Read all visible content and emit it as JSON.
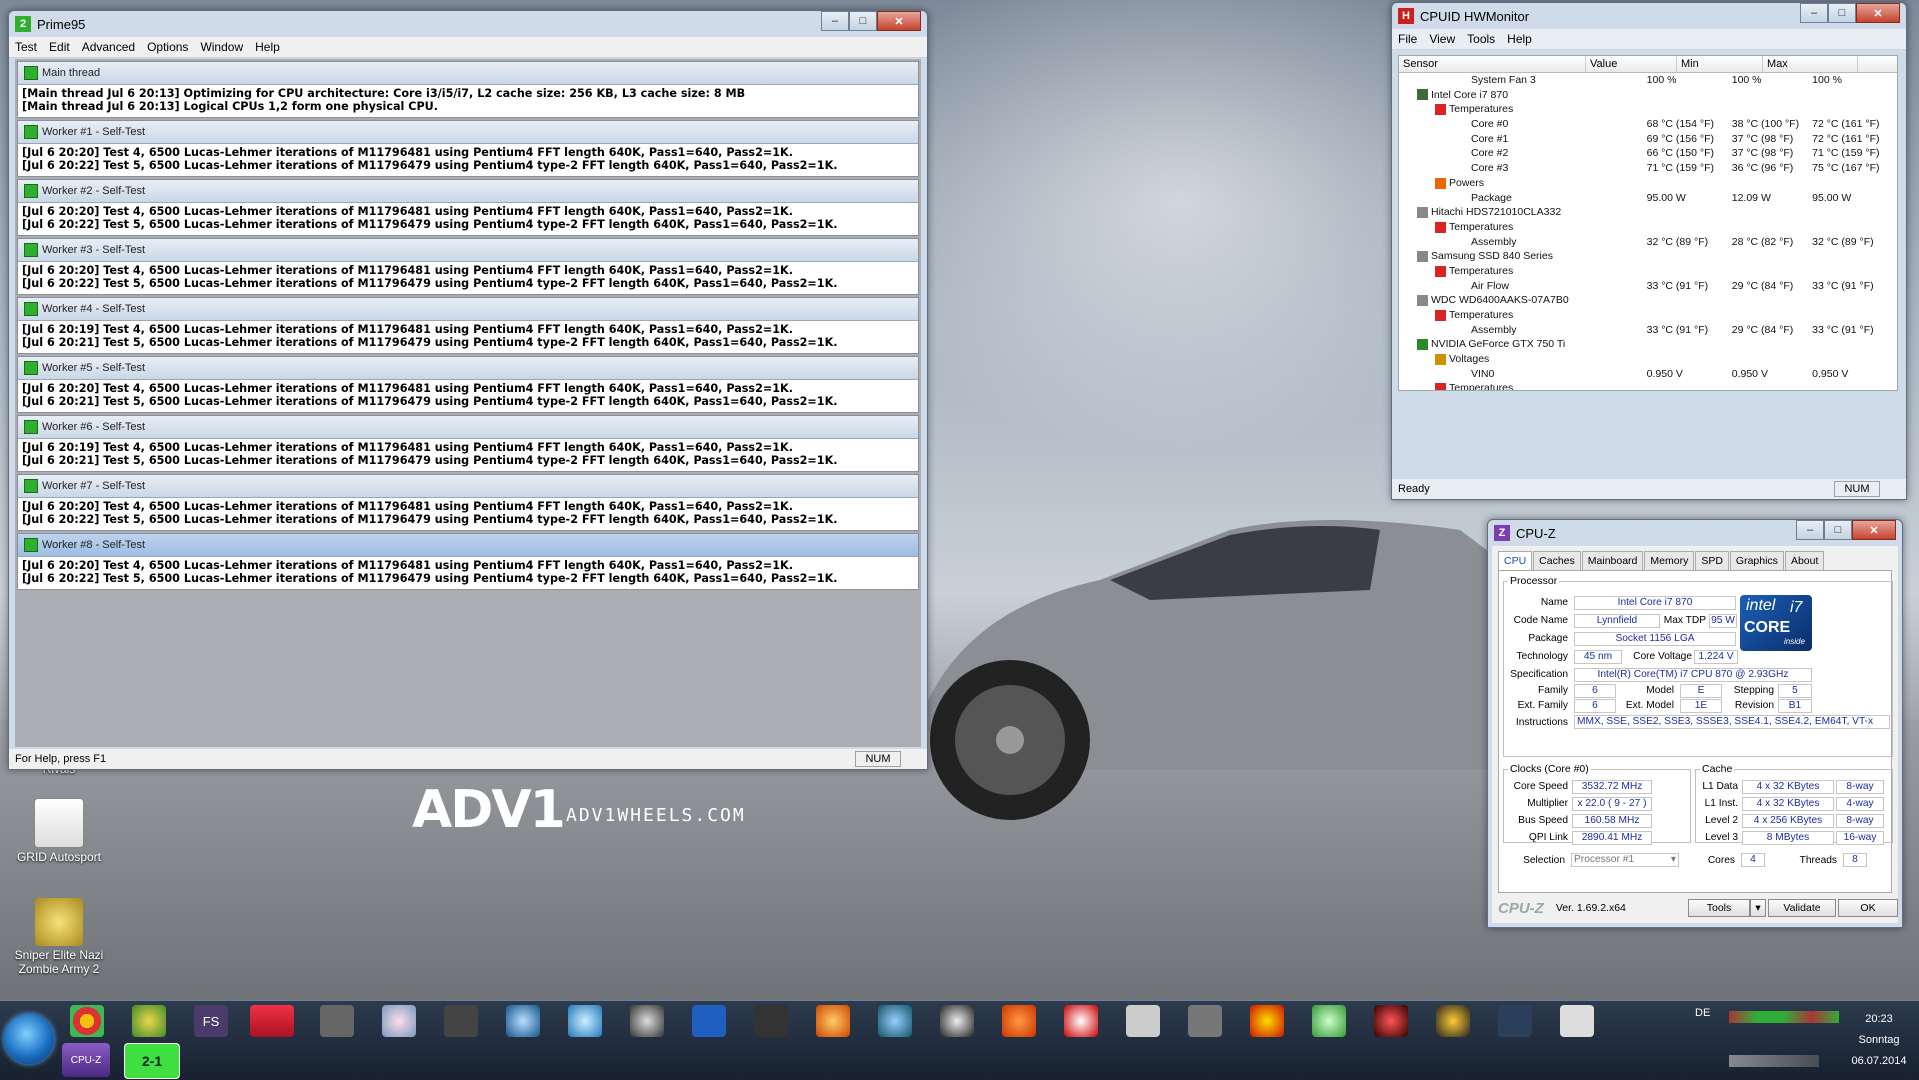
{
  "prime95": {
    "title": "Prime95",
    "menu": [
      "Test",
      "Edit",
      "Advanced",
      "Options",
      "Window",
      "Help"
    ],
    "panes": [
      {
        "title": "Main thread",
        "lines": [
          "[Main thread Jul 6 20:13] Optimizing for CPU architecture: Core i3/i5/i7, L2 cache size: 256 KB, L3 cache size: 8 MB",
          "[Main thread Jul 6 20:13] Logical CPUs 1,2 form one physical CPU."
        ]
      },
      {
        "title": "Worker #1 - Self-Test",
        "lines": [
          "[Jul 6 20:20] Test 4, 6500 Lucas-Lehmer iterations of M11796481 using Pentium4 FFT length 640K, Pass1=640, Pass2=1K.",
          "[Jul 6 20:22] Test 5, 6500 Lucas-Lehmer iterations of M11796479 using Pentium4 type-2 FFT length 640K, Pass1=640, Pass2=1K."
        ]
      },
      {
        "title": "Worker #2 - Self-Test",
        "lines": [
          "[Jul 6 20:20] Test 4, 6500 Lucas-Lehmer iterations of M11796481 using Pentium4 FFT length 640K, Pass1=640, Pass2=1K.",
          "[Jul 6 20:22] Test 5, 6500 Lucas-Lehmer iterations of M11796479 using Pentium4 type-2 FFT length 640K, Pass1=640, Pass2=1K."
        ]
      },
      {
        "title": "Worker #3 - Self-Test",
        "lines": [
          "[Jul 6 20:20] Test 4, 6500 Lucas-Lehmer iterations of M11796481 using Pentium4 FFT length 640K, Pass1=640, Pass2=1K.",
          "[Jul 6 20:22] Test 5, 6500 Lucas-Lehmer iterations of M11796479 using Pentium4 type-2 FFT length 640K, Pass1=640, Pass2=1K."
        ]
      },
      {
        "title": "Worker #4 - Self-Test",
        "lines": [
          "[Jul 6 20:19] Test 4, 6500 Lucas-Lehmer iterations of M11796481 using Pentium4 FFT length 640K, Pass1=640, Pass2=1K.",
          "[Jul 6 20:21] Test 5, 6500 Lucas-Lehmer iterations of M11796479 using Pentium4 type-2 FFT length 640K, Pass1=640, Pass2=1K."
        ]
      },
      {
        "title": "Worker #5 - Self-Test",
        "lines": [
          "[Jul 6 20:20] Test 4, 6500 Lucas-Lehmer iterations of M11796481 using Pentium4 FFT length 640K, Pass1=640, Pass2=1K.",
          "[Jul 6 20:21] Test 5, 6500 Lucas-Lehmer iterations of M11796479 using Pentium4 type-2 FFT length 640K, Pass1=640, Pass2=1K."
        ]
      },
      {
        "title": "Worker #6 - Self-Test",
        "lines": [
          "[Jul 6 20:19] Test 4, 6500 Lucas-Lehmer iterations of M11796481 using Pentium4 FFT length 640K, Pass1=640, Pass2=1K.",
          "[Jul 6 20:21] Test 5, 6500 Lucas-Lehmer iterations of M11796479 using Pentium4 type-2 FFT length 640K, Pass1=640, Pass2=1K."
        ]
      },
      {
        "title": "Worker #7 - Self-Test",
        "lines": [
          "[Jul 6 20:20] Test 4, 6500 Lucas-Lehmer iterations of M11796481 using Pentium4 FFT length 640K, Pass1=640, Pass2=1K.",
          "[Jul 6 20:22] Test 5, 6500 Lucas-Lehmer iterations of M11796479 using Pentium4 type-2 FFT length 640K, Pass1=640, Pass2=1K."
        ]
      },
      {
        "title": "Worker #8 - Self-Test",
        "lines": [
          "[Jul 6 20:20] Test 4, 6500 Lucas-Lehmer iterations of M11796481 using Pentium4 FFT length 640K, Pass1=640, Pass2=1K.",
          "[Jul 6 20:22] Test 5, 6500 Lucas-Lehmer iterations of M11796479 using Pentium4 type-2 FFT length 640K, Pass1=640, Pass2=1K."
        ]
      }
    ],
    "status": "For Help, press F1",
    "num": "NUM"
  },
  "hwmonitor": {
    "title": "CPUID HWMonitor",
    "menu": [
      "File",
      "View",
      "Tools",
      "Help"
    ],
    "columns": [
      "Sensor",
      "Value",
      "Min",
      "Max"
    ],
    "rows": [
      {
        "indent": 4,
        "name": "System Fan 3",
        "value": "100 %",
        "min": "100 %",
        "max": "100 %",
        "icon": "none"
      },
      {
        "indent": 1,
        "name": "Intel Core i7 870",
        "value": "",
        "min": "",
        "max": "",
        "icon": "chip"
      },
      {
        "indent": 2,
        "name": "Temperatures",
        "value": "",
        "min": "",
        "max": "",
        "icon": "therm"
      },
      {
        "indent": 4,
        "name": "Core #0",
        "value": "68 °C  (154 °F)",
        "min": "38 °C  (100 °F)",
        "max": "72 °C  (161 °F)",
        "icon": "none"
      },
      {
        "indent": 4,
        "name": "Core #1",
        "value": "69 °C  (156 °F)",
        "min": "37 °C  (98 °F)",
        "max": "72 °C  (161 °F)",
        "icon": "none"
      },
      {
        "indent": 4,
        "name": "Core #2",
        "value": "66 °C  (150 °F)",
        "min": "37 °C  (98 °F)",
        "max": "71 °C  (159 °F)",
        "icon": "none"
      },
      {
        "indent": 4,
        "name": "Core #3",
        "value": "71 °C  (159 °F)",
        "min": "36 °C  (96 °F)",
        "max": "75 °C  (167 °F)",
        "icon": "none"
      },
      {
        "indent": 2,
        "name": "Powers",
        "value": "",
        "min": "",
        "max": "",
        "icon": "power"
      },
      {
        "indent": 4,
        "name": "Package",
        "value": "95.00 W",
        "min": "12.09 W",
        "max": "95.00 W",
        "icon": "none"
      },
      {
        "indent": 1,
        "name": "Hitachi HDS721010CLA332",
        "value": "",
        "min": "",
        "max": "",
        "icon": "disk"
      },
      {
        "indent": 2,
        "name": "Temperatures",
        "value": "",
        "min": "",
        "max": "",
        "icon": "therm"
      },
      {
        "indent": 4,
        "name": "Assembly",
        "value": "32 °C  (89 °F)",
        "min": "28 °C  (82 °F)",
        "max": "32 °C  (89 °F)",
        "icon": "none"
      },
      {
        "indent": 1,
        "name": "Samsung SSD 840 Series",
        "value": "",
        "min": "",
        "max": "",
        "icon": "disk"
      },
      {
        "indent": 2,
        "name": "Temperatures",
        "value": "",
        "min": "",
        "max": "",
        "icon": "therm"
      },
      {
        "indent": 4,
        "name": "Air Flow",
        "value": "33 °C  (91 °F)",
        "min": "29 °C  (84 °F)",
        "max": "33 °C  (91 °F)",
        "icon": "none"
      },
      {
        "indent": 1,
        "name": "WDC WD6400AAKS-07A7B0",
        "value": "",
        "min": "",
        "max": "",
        "icon": "disk"
      },
      {
        "indent": 2,
        "name": "Temperatures",
        "value": "",
        "min": "",
        "max": "",
        "icon": "therm"
      },
      {
        "indent": 4,
        "name": "Assembly",
        "value": "33 °C  (91 °F)",
        "min": "29 °C  (84 °F)",
        "max": "33 °C  (91 °F)",
        "icon": "none"
      },
      {
        "indent": 1,
        "name": "NVIDIA GeForce GTX 750 Ti",
        "value": "",
        "min": "",
        "max": "",
        "icon": "gpu"
      },
      {
        "indent": 2,
        "name": "Voltages",
        "value": "",
        "min": "",
        "max": "",
        "icon": "volt"
      },
      {
        "indent": 4,
        "name": "VIN0",
        "value": "0.950 V",
        "min": "0.950 V",
        "max": "0.950 V",
        "icon": "none"
      },
      {
        "indent": 2,
        "name": "Temperatures",
        "value": "",
        "min": "",
        "max": "",
        "icon": "therm"
      }
    ],
    "status": "Ready",
    "num": "NUM"
  },
  "cpuz": {
    "title": "CPU-Z",
    "tabs": [
      "CPU",
      "Caches",
      "Mainboard",
      "Memory",
      "SPD",
      "Graphics",
      "About"
    ],
    "processor_legend": "Processor",
    "name_label": "Name",
    "name": "Intel Core i7 870",
    "codename_label": "Code Name",
    "codename": "Lynnfield",
    "maxtdp_label": "Max TDP",
    "maxtdp": "95 W",
    "package_label": "Package",
    "package": "Socket 1156 LGA",
    "technology_label": "Technology",
    "technology": "45 nm",
    "corevoltage_label": "Core Voltage",
    "corevoltage": "1.224 V",
    "spec_label": "Specification",
    "spec": "Intel(R) Core(TM) i7 CPU        870  @ 2.93GHz",
    "family_label": "Family",
    "family": "6",
    "model_label": "Model",
    "model": "E",
    "stepping_label": "Stepping",
    "stepping": "5",
    "extfamily_label": "Ext. Family",
    "extfamily": "6",
    "extmodel_label": "Ext. Model",
    "extmodel": "1E",
    "revision_label": "Revision",
    "revision": "B1",
    "instructions_label": "Instructions",
    "instructions": "MMX, SSE, SSE2, SSE3, SSSE3, SSE4.1, SSE4.2, EM64T, VT-x",
    "clocks_legend": "Clocks (Core #0)",
    "corespeed_label": "Core Speed",
    "corespeed": "3532.72 MHz",
    "multiplier_label": "Multiplier",
    "multiplier": "x 22.0 ( 9 - 27 )",
    "busspeed_label": "Bus Speed",
    "busspeed": "160.58 MHz",
    "qpilink_label": "QPI Link",
    "qpilink": "2890.41 MHz",
    "cache_legend": "Cache",
    "l1data_label": "L1 Data",
    "l1data": "4 x 32 KBytes",
    "l1data_way": "8-way",
    "l1inst_label": "L1 Inst.",
    "l1inst": "4 x 32 KBytes",
    "l1inst_way": "4-way",
    "l2_label": "Level 2",
    "l2": "4 x 256 KBytes",
    "l2_way": "8-way",
    "l3_label": "Level 3",
    "l3": "8 MBytes",
    "l3_way": "16-way",
    "selection_label": "Selection",
    "selection": "Processor #1",
    "cores_label": "Cores",
    "cores": "4",
    "threads_label": "Threads",
    "threads": "8",
    "brand": "CPU-Z",
    "version": "Ver. 1.69.2.x64",
    "tools": "Tools",
    "validate": "Validate",
    "ok": "OK",
    "intel_word": "intel",
    "intel_core": "CORE",
    "intel_i7": "i7",
    "intel_inside": "inside"
  },
  "desktop": {
    "icons": [
      {
        "label": "Rivals",
        "name": "rivals"
      },
      {
        "label": "GRID Autosport",
        "name": "grid-autosport"
      },
      {
        "label": "Sniper Elite Nazi Zombie Army 2",
        "name": "sniper-elite"
      }
    ],
    "wallpaper_brand": "ADV1",
    "wallpaper_url": "ADV1WHEELS.COM"
  },
  "taskbar": {
    "language": "DE",
    "time": "20:23",
    "day": "Sonntag",
    "date": "06.07.2014",
    "cpuz_btn": "CPU-Z",
    "p95_btn": "2-1"
  }
}
